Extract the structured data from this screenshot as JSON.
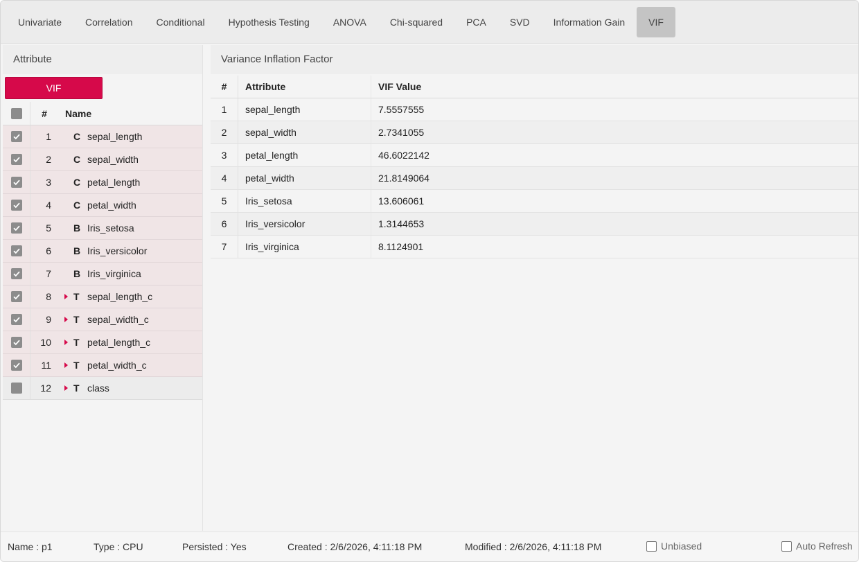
{
  "tabs": [
    {
      "label": "Univariate"
    },
    {
      "label": "Correlation"
    },
    {
      "label": "Conditional"
    },
    {
      "label": "Hypothesis Testing"
    },
    {
      "label": "ANOVA"
    },
    {
      "label": "Chi-squared"
    },
    {
      "label": "PCA"
    },
    {
      "label": "SVD"
    },
    {
      "label": "Information Gain"
    },
    {
      "label": "VIF"
    }
  ],
  "active_tab": "VIF",
  "left": {
    "title": "Attribute",
    "button_label": "VIF",
    "headers": {
      "num": "#",
      "name": "Name"
    },
    "rows": [
      {
        "num": "1",
        "type": "C",
        "name": "sepal_length"
      },
      {
        "num": "2",
        "type": "C",
        "name": "sepal_width"
      },
      {
        "num": "3",
        "type": "C",
        "name": "petal_length"
      },
      {
        "num": "4",
        "type": "C",
        "name": "petal_width"
      },
      {
        "num": "5",
        "type": "B",
        "name": "Iris_setosa"
      },
      {
        "num": "6",
        "type": "B",
        "name": "Iris_versicolor"
      },
      {
        "num": "7",
        "type": "B",
        "name": "Iris_virginica"
      },
      {
        "num": "8",
        "type": "T",
        "name": "sepal_length_c"
      },
      {
        "num": "9",
        "type": "T",
        "name": "sepal_width_c"
      },
      {
        "num": "10",
        "type": "T",
        "name": "petal_length_c"
      },
      {
        "num": "11",
        "type": "T",
        "name": "petal_width_c"
      },
      {
        "num": "12",
        "type": "T",
        "name": "class"
      }
    ]
  },
  "right": {
    "title": "Variance Inflation Factor",
    "headers": {
      "num": "#",
      "attribute": "Attribute",
      "value": "VIF Value"
    },
    "rows": [
      {
        "num": "1",
        "attribute": "sepal_length",
        "value": "7.5557555"
      },
      {
        "num": "2",
        "attribute": "sepal_width",
        "value": "2.7341055"
      },
      {
        "num": "3",
        "attribute": "petal_length",
        "value": "46.6022142"
      },
      {
        "num": "4",
        "attribute": "petal_width",
        "value": "21.8149064"
      },
      {
        "num": "5",
        "attribute": "Iris_setosa",
        "value": "13.606061"
      },
      {
        "num": "6",
        "attribute": "Iris_versicolor",
        "value": "1.3144653"
      },
      {
        "num": "7",
        "attribute": "Iris_virginica",
        "value": "8.1124901"
      }
    ]
  },
  "footer": {
    "name": "Name : p1",
    "type": "Type : CPU",
    "persisted": "Persisted : Yes",
    "created": "Created : 2/6/2026, 4:11:18 PM",
    "modified": "Modified : 2/6/2026, 4:11:18 PM",
    "unbiased": "Unbiased",
    "auto_refresh": "Auto Refresh"
  },
  "colors": {
    "accent": "#d6094a",
    "checked_row": "#f0e5e6",
    "active_tab": "#c4c4c4"
  }
}
